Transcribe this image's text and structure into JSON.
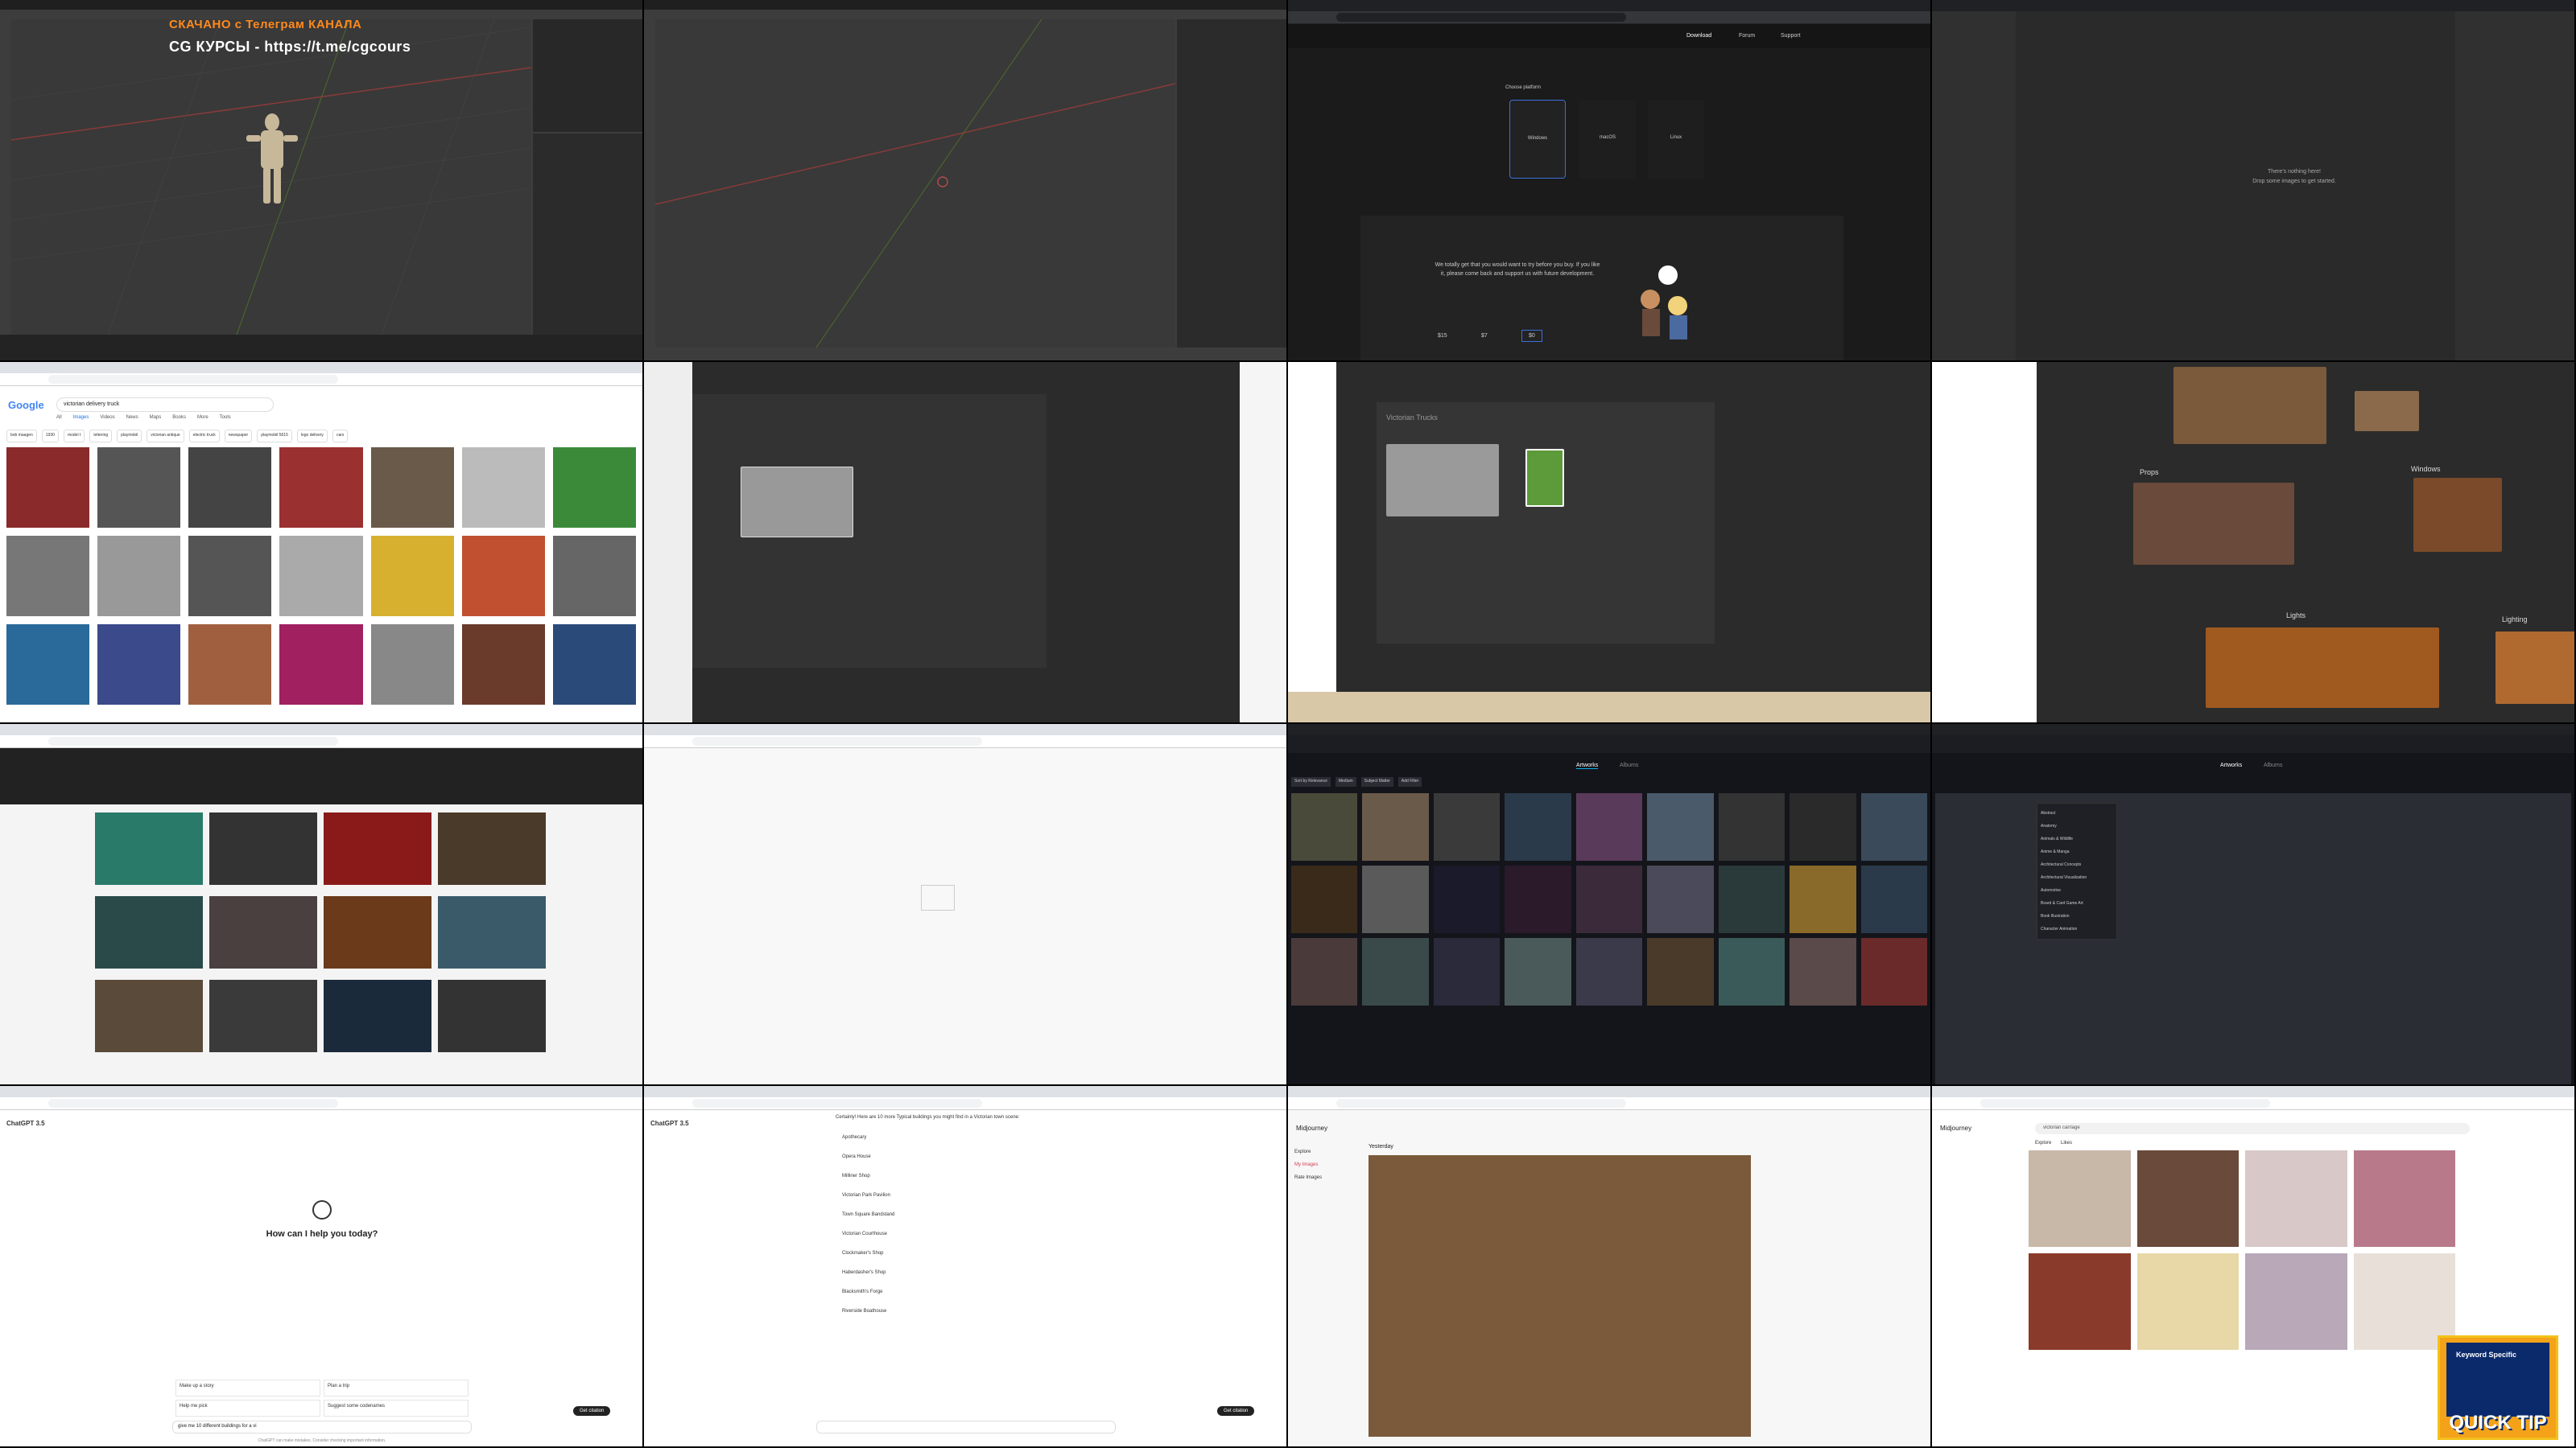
{
  "overlay": {
    "line1": "СКАЧАНО с Телеграм КАНАЛА",
    "line2": "CG КУРСЫ - https://t.me/cgcours"
  },
  "blender_install": {
    "nav": [
      "Download",
      "Forum",
      "Support"
    ],
    "platform_label": "Choose platform",
    "platforms": [
      "Windows",
      "macOS",
      "Linux"
    ],
    "message": "We totally get that you would want to try before you buy. If you like it, please come back and support us with future development.",
    "prices": [
      "$15",
      "$7",
      "$0"
    ]
  },
  "empty_project": {
    "line1": "There's nothing here!",
    "line2": "Drop some images to get started."
  },
  "google": {
    "logo": "Google",
    "query": "victorian delivery truck",
    "tabs": [
      "All",
      "Images",
      "Videos",
      "News",
      "Maps",
      "Books",
      "More",
      "Tools"
    ],
    "chips": [
      "bob maagen",
      "1930",
      "model t",
      "lettering",
      "playmobil",
      "victorian antique",
      "electric truck",
      "newspaper",
      "playmobil 5615",
      "lego delivery",
      "cars"
    ]
  },
  "pureref": {
    "board_title": "Victorian Trucks",
    "groups": [
      "Props",
      "Windows",
      "Lights",
      "Lighting"
    ]
  },
  "artstation": {
    "tabs": [
      "Artworks",
      "Albums"
    ],
    "filters": [
      "Sort by Relevance",
      "Medium",
      "Subject Matter",
      "Add Filter"
    ],
    "dropdown": [
      "Abstract",
      "Anatomy",
      "Animals & Wildlife",
      "Anime & Manga",
      "Architectural Concepts",
      "Architectural Visualization",
      "Automotive",
      "Board & Card Game Art",
      "Book Illustration",
      "Character Animation"
    ]
  },
  "chatgpt": {
    "model": "ChatGPT 3.5",
    "greeting": "How can I help you today?",
    "suggestions": [
      "Make up a story",
      "Plan a trip",
      "Help me pick",
      "Suggest some codenames"
    ],
    "input": "give me 10 different buildings for a vi",
    "response_intro": "Certainly! Here are 10 more Typical buildings you might find in a Victorian town scene:",
    "response_items": [
      "Apothecary",
      "Opera House",
      "Milliner Shop",
      "Victorian Park Pavilion",
      "Town Square Bandstand",
      "Victorian Courthouse",
      "Clockmaker's Shop",
      "Haberdasher's Shop",
      "Blacksmith's Forge",
      "Riverside Boathouse"
    ],
    "footer": "ChatGPT can make mistakes. Consider checking important information.",
    "get_btn": "Get citation"
  },
  "midjourney": {
    "brand": "Midjourney",
    "nav": [
      "Explore",
      "My Images",
      "Rate Images"
    ],
    "section": "Yesterday",
    "search": "victorian carriage",
    "tabs": [
      "Explore",
      "Likes"
    ]
  },
  "quick_tip": {
    "title": "Keyword Specific",
    "label": "QUICK TIP"
  },
  "colors": {
    "accent_orange": "#ff8a1d",
    "artstation_blue": "#13aff0",
    "chatgpt_green": "#10a37f"
  }
}
